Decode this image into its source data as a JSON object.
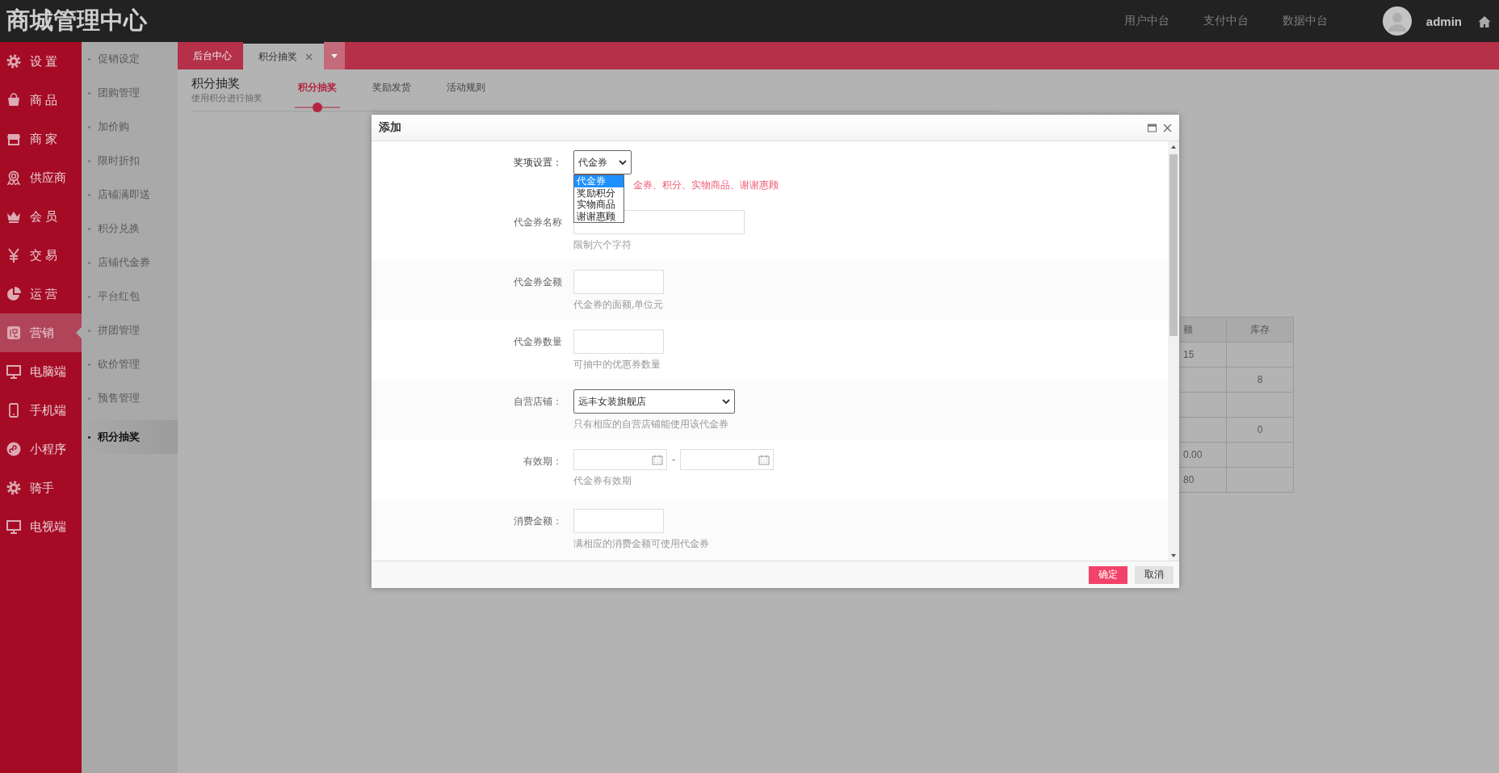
{
  "header": {
    "title": "商城管理中心",
    "nav": [
      {
        "label": "用户中台"
      },
      {
        "label": "支付中台"
      },
      {
        "label": "数据中台"
      }
    ],
    "user": "admin"
  },
  "sidebar": {
    "items": [
      {
        "label": "设 置",
        "selected": false
      },
      {
        "label": "商 品",
        "selected": false
      },
      {
        "label": "商 家",
        "selected": false
      },
      {
        "label": "供应商",
        "selected": false
      },
      {
        "label": "会 员",
        "selected": false
      },
      {
        "label": "交 易",
        "selected": false
      },
      {
        "label": "运 营",
        "selected": false
      },
      {
        "label": "营销",
        "selected": true
      },
      {
        "label": "电脑端",
        "selected": false
      },
      {
        "label": "手机端",
        "selected": false
      },
      {
        "label": "小程序",
        "selected": false
      },
      {
        "label": "骑手",
        "selected": false
      },
      {
        "label": "电视端",
        "selected": false
      }
    ]
  },
  "submenu": {
    "items": [
      {
        "label": "促销设定",
        "selected": false
      },
      {
        "label": "团购管理",
        "selected": false
      },
      {
        "label": "加价购",
        "selected": false
      },
      {
        "label": "限时折扣",
        "selected": false
      },
      {
        "label": "店铺满即送",
        "selected": false
      },
      {
        "label": "积分兑换",
        "selected": false
      },
      {
        "label": "店铺代金券",
        "selected": false
      },
      {
        "label": "平台红包",
        "selected": false
      },
      {
        "label": "拼团管理",
        "selected": false
      },
      {
        "label": "砍价管理",
        "selected": false
      },
      {
        "label": "预售管理",
        "selected": false
      },
      {
        "label": "积分抽奖",
        "selected": true
      }
    ]
  },
  "tabs": [
    {
      "label": "后台中心",
      "selected": false,
      "closable": false
    },
    {
      "label": "积分抽奖",
      "selected": true,
      "closable": true
    }
  ],
  "page": {
    "title": "积分抽奖",
    "subtitle": "使用积分进行抽奖",
    "tabs": [
      {
        "label": "积分抽奖",
        "selected": true
      },
      {
        "label": "奖励发货",
        "selected": false
      },
      {
        "label": "活动规则",
        "selected": false
      }
    ]
  },
  "table": {
    "columns": [
      {
        "label": "额"
      },
      {
        "label": "库存"
      }
    ],
    "rows": [
      [
        "15",
        ""
      ],
      [
        "",
        "8"
      ],
      [
        "",
        ""
      ],
      [
        "",
        "0"
      ],
      [
        "0.00",
        ""
      ],
      [
        "80",
        ""
      ]
    ]
  },
  "dialog": {
    "title": "添加",
    "fields": [
      {
        "kind": "select",
        "label": "奖项设置：",
        "value": "代金券",
        "open": true,
        "options": [
          {
            "label": "代金券",
            "selected": true
          },
          {
            "label": "奖励积分",
            "selected": false
          },
          {
            "label": "实物商品",
            "selected": false
          },
          {
            "label": "谢谢惠顾",
            "selected": false
          }
        ],
        "hint": "金券、积分、实物商品、谢谢惠顾",
        "hint_warning": true
      },
      {
        "kind": "text",
        "label": "代金券名称",
        "hint": "限制六个字符",
        "hint_warning": false
      },
      {
        "kind": "text",
        "label": "代金券金额",
        "hint": "代金券的面额,单位元",
        "hint_warning": false
      },
      {
        "kind": "text",
        "label": "代金券数量",
        "hint": "可抽中的优惠券数量",
        "hint_warning": false
      },
      {
        "kind": "select",
        "label": "自营店铺：",
        "value": "远丰女装旗舰店",
        "open": false,
        "hint": "只有相应的自营店铺能使用该代金券",
        "hint_warning": false
      },
      {
        "kind": "daterange",
        "label": "有效期：",
        "separator": "-",
        "hint": "代金券有效期",
        "hint_warning": false
      },
      {
        "kind": "text",
        "label": "消费金额：",
        "hint": "满相应的消费金额可使用代金券",
        "hint_warning": false
      }
    ],
    "buttons": [
      {
        "label": "确定",
        "kind": "primary"
      },
      {
        "label": "取消",
        "kind": "default"
      }
    ]
  }
}
